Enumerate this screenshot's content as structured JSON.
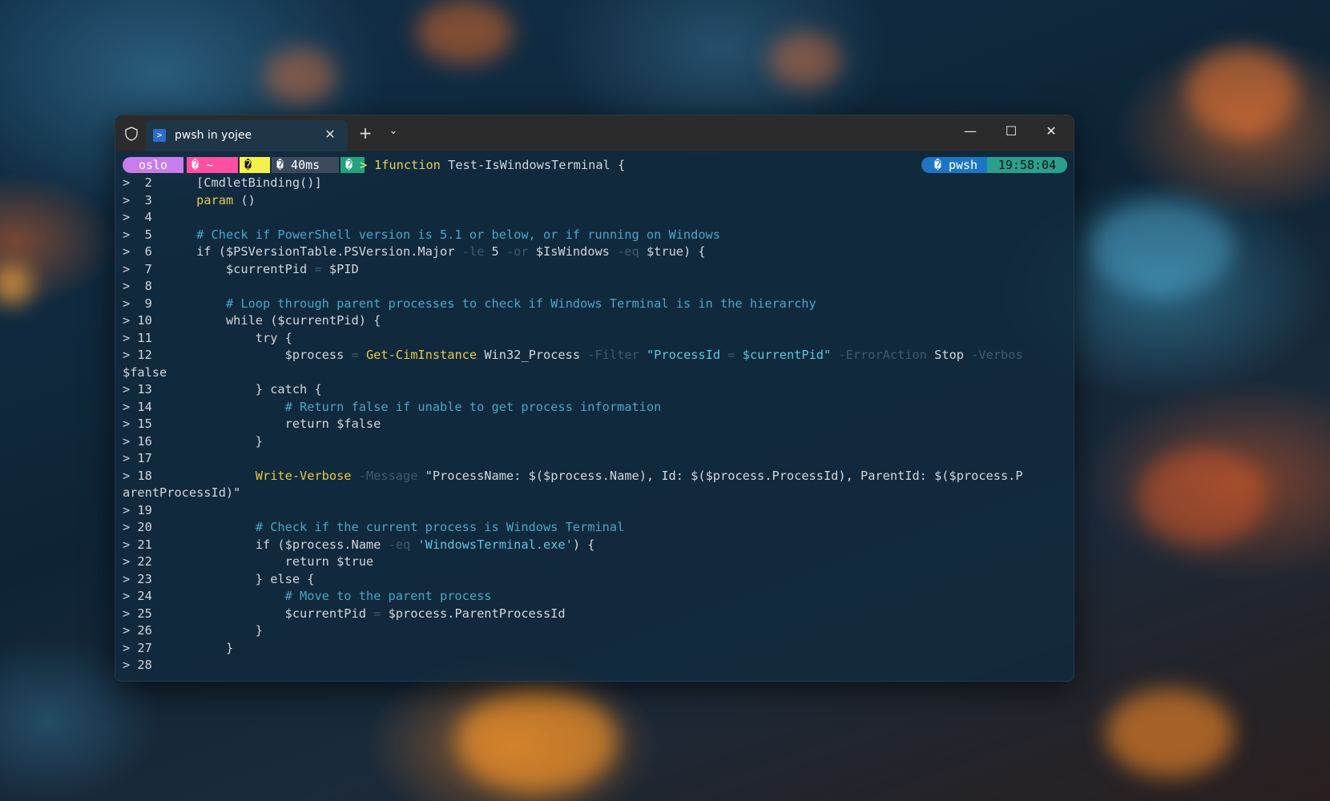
{
  "window": {
    "tab_title": "pwsh in yojee",
    "tab_icon": "powershell-icon",
    "new_tab_label": "+",
    "dropdown_label": "⌄",
    "close_tab_label": "✕",
    "minimize_label": "—",
    "maximize_label": "☐",
    "close_label": "✕"
  },
  "prompt": {
    "segments": [
      {
        "text": "oslo",
        "color": "#c77dea"
      },
      {
        "text": "� ~",
        "color": "#ff4fa3"
      },
      {
        "text": "�",
        "color": "#f5f04a"
      },
      {
        "text": "� 40ms",
        "color": "#3b4a5c"
      },
      {
        "text": "�",
        "color": "#23a37d"
      }
    ],
    "arrow": ">",
    "first_line_number": "1",
    "first_line_code": "function Test-IsWindowsTerminal {",
    "right_shell": "� pwsh",
    "right_shell_color": "#1d76c4",
    "right_time": "19:58:04",
    "right_time_color": "#2b9e8e"
  },
  "code_lines": [
    {
      "n": "2",
      "t": "    [CmdletBinding()]"
    },
    {
      "n": "3",
      "t": "    param ()"
    },
    {
      "n": "4",
      "t": ""
    },
    {
      "n": "5",
      "t": "    # Check if PowerShell version is 5.1 or below, or if running on Windows"
    },
    {
      "n": "6",
      "t": "    if ($PSVersionTable.PSVersion.Major -le 5 -or $IsWindows -eq $true) {"
    },
    {
      "n": "7",
      "t": "        $currentPid = $PID"
    },
    {
      "n": "8",
      "t": ""
    },
    {
      "n": "9",
      "t": "        # Loop through parent processes to check if Windows Terminal is in the hierarchy"
    },
    {
      "n": "10",
      "t": "        while ($currentPid) {"
    },
    {
      "n": "11",
      "t": "            try {"
    },
    {
      "n": "12",
      "t": "                $process = Get-CimInstance Win32_Process -Filter \"ProcessId = $currentPid\" -ErrorAction Stop -Verbos"
    },
    {
      "n": "",
      "t": "$false"
    },
    {
      "n": "13",
      "t": "            } catch {"
    },
    {
      "n": "14",
      "t": "                # Return false if unable to get process information"
    },
    {
      "n": "15",
      "t": "                return $false"
    },
    {
      "n": "16",
      "t": "            }"
    },
    {
      "n": "17",
      "t": ""
    },
    {
      "n": "18",
      "t": "            Write-Verbose -Message \"ProcessName: $($process.Name), Id: $($process.ProcessId), ParentId: $($process.P"
    },
    {
      "n": "",
      "t": "arentProcessId)\""
    },
    {
      "n": "19",
      "t": ""
    },
    {
      "n": "20",
      "t": "            # Check if the current process is Windows Terminal"
    },
    {
      "n": "21",
      "t": "            if ($process.Name -eq 'WindowsTerminal.exe') {"
    },
    {
      "n": "22",
      "t": "                return $true"
    },
    {
      "n": "23",
      "t": "            } else {"
    },
    {
      "n": "24",
      "t": "                # Move to the parent process"
    },
    {
      "n": "25",
      "t": "                $currentPid = $process.ParentProcessId"
    },
    {
      "n": "26",
      "t": "            }"
    },
    {
      "n": "27",
      "t": "        }"
    },
    {
      "n": "28",
      "t": ""
    }
  ]
}
